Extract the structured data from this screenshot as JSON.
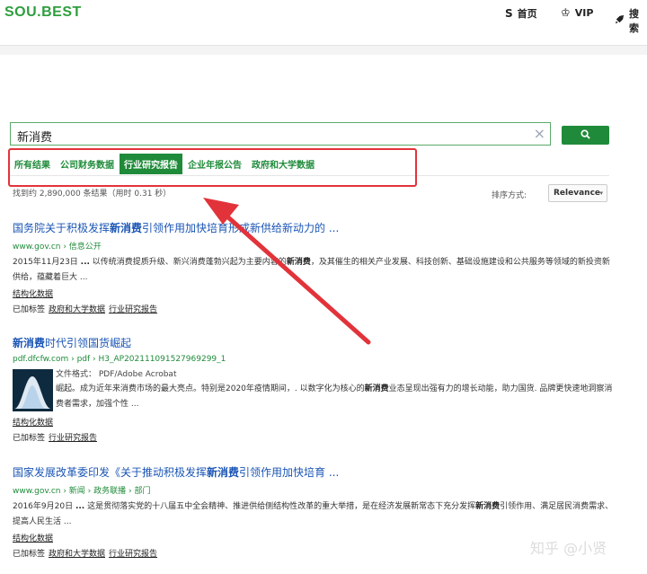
{
  "header": {
    "logo": "SOU.BEST",
    "nav": [
      {
        "icon": "S",
        "label": "首页"
      },
      {
        "icon": "♔",
        "label": "VIP"
      },
      {
        "icon": "🚀",
        "label": "搜索"
      }
    ]
  },
  "search": {
    "value": "新消费",
    "clear_icon": "✕",
    "button_icon": "magnifier-icon",
    "tabs": [
      "所有结果",
      "公司财务数据",
      "行业研究报告",
      "企业年报公告",
      "政府和大学数据"
    ],
    "active_tab": "行业研究报告",
    "stats": "找到约 2,890,000 条结果（用时 0.31 秒）",
    "sort_label": "排序方式:",
    "sort_value": "Relevance"
  },
  "results": [
    {
      "title_pre": "国务院关于积极发挥",
      "title_bold": "新消费",
      "title_post": "引领作用加快培育形成新供给新动力的 ...",
      "url": "www.gov.cn › 信息公开",
      "snippet": [
        {
          "text": "2015年11月23日 ",
          "b": false
        },
        {
          "text": "...",
          "b": true
        },
        {
          "text": " 以传统消费提质升级、新兴消费蓬勃兴起为主要内容的",
          "b": false
        },
        {
          "text": "新消费",
          "b": true
        },
        {
          "text": "，及其催生的相关产业发展、科技创新、基础设施建设和公共服务等领域的新投资新供给，蕴藏着巨大 ...",
          "b": false
        }
      ],
      "structured_label": "结构化数据",
      "tags_label": "已加标签",
      "tags": [
        "政府和大学数据",
        "行业研究报告"
      ]
    },
    {
      "title_pre": "",
      "title_bold": "新消费",
      "title_post": "时代引领国货崛起",
      "url": "pdf.dfcfw.com › pdf › H3_AP202111091527969299_1",
      "file_format": "文件格式：  PDF/Adobe Acrobat",
      "snippet": [
        {
          "text": "崛起。成为近年来消费市场的最大亮点。特别是2020年疫情期间，. 以数字化为核心的",
          "b": false
        },
        {
          "text": "新消费",
          "b": true
        },
        {
          "text": "业态呈现出强有力的增长动能，助力国货. 品牌更快速地洞察消费者需求，加强个性 ...",
          "b": false
        }
      ],
      "structured_label": "结构化数据",
      "tags_label": "已加标签",
      "tags": [
        "行业研究报告"
      ]
    },
    {
      "title_pre": "国家发展改革委印发《关于推动积极发挥",
      "title_bold": "新消费",
      "title_post": "引领作用加快培育 ...",
      "url": "www.gov.cn › 新闻 › 政务联播 › 部门",
      "snippet": [
        {
          "text": "2016年9月20日 ",
          "b": false
        },
        {
          "text": "...",
          "b": true
        },
        {
          "text": " 这是贯彻落实党的十八届五中全会精神、推进供给侧结构性改革的重大举措，是在经济发展新常态下充分发挥",
          "b": false
        },
        {
          "text": "新消费",
          "b": true
        },
        {
          "text": "引领作用、满足居民消费需求、提高人民生活 ...",
          "b": false
        }
      ],
      "structured_label": "结构化数据",
      "tags_label": "已加标签",
      "tags": [
        "政府和大学数据",
        "行业研究报告"
      ]
    }
  ],
  "watermark": "知乎 @小贤",
  "annotation_color": "#e2333a"
}
